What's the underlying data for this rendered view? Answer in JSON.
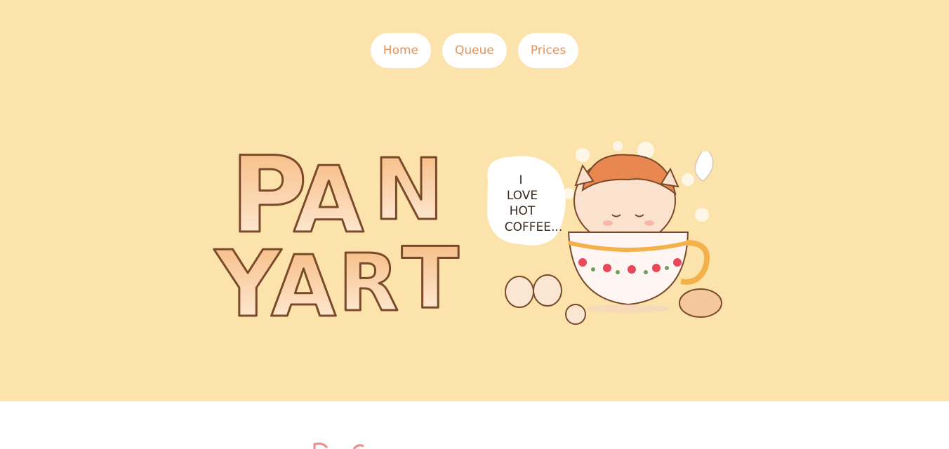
{
  "nav": {
    "items": [
      {
        "label": "Home"
      },
      {
        "label": "Queue"
      },
      {
        "label": "Prices"
      }
    ]
  },
  "banner": {
    "logo_text": "PAN YART",
    "speech_bubble": "I LOVE HOT COFFEE..."
  },
  "colors": {
    "hero_background": "#fce3ab",
    "nav_text": "#e4915a",
    "nav_pill": "#ffffff",
    "logo_outline": "#7a4a2a",
    "logo_fill": "#f7c58f"
  }
}
